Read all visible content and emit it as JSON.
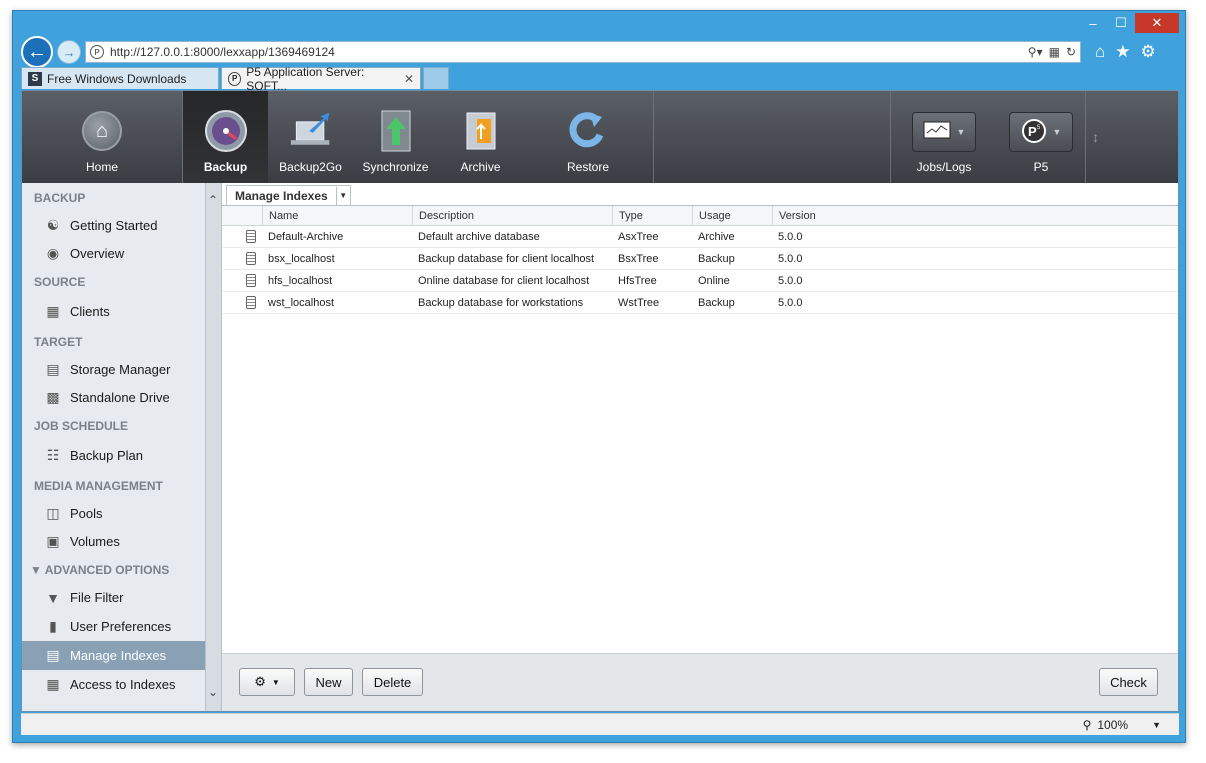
{
  "browser": {
    "url": "http://127.0.0.1:8000/lexxapp/1369469124",
    "tabs": [
      {
        "label": "Free Windows Downloads",
        "favicon": "S"
      },
      {
        "label": "P5 Application Server: SOFT...",
        "favicon": "P"
      }
    ],
    "zoom": "100%",
    "window_controls": {
      "minimize": "‒",
      "maximize": "☐",
      "close": "✕"
    }
  },
  "toolbar": {
    "items": [
      {
        "label": "Home",
        "icon": "home-icon"
      },
      {
        "label": "Backup",
        "icon": "backup-gauge-icon"
      },
      {
        "label": "Backup2Go",
        "icon": "laptop-upload-icon"
      },
      {
        "label": "Synchronize",
        "icon": "sync-arrows-icon"
      },
      {
        "label": "Archive",
        "icon": "archive-safe-icon"
      },
      {
        "label": "Restore",
        "icon": "restore-arrow-icon"
      }
    ],
    "right": [
      {
        "label": "Jobs/Logs",
        "icon": "monitor-graph-icon"
      },
      {
        "label": "P5",
        "icon": "p5-logo-icon"
      }
    ]
  },
  "sidebar": {
    "sections": [
      {
        "title": "BACKUP",
        "items": [
          "Getting Started",
          "Overview"
        ]
      },
      {
        "title": "SOURCE",
        "items": [
          "Clients"
        ]
      },
      {
        "title": "TARGET",
        "items": [
          "Storage Manager",
          "Standalone Drive"
        ]
      },
      {
        "title": "JOB SCHEDULE",
        "items": [
          "Backup Plan"
        ]
      },
      {
        "title": "MEDIA MANAGEMENT",
        "items": [
          "Pools",
          "Volumes"
        ]
      },
      {
        "title": "ADVANCED OPTIONS",
        "items": [
          "File Filter",
          "User Preferences",
          "Manage Indexes",
          "Access to Indexes"
        ]
      }
    ],
    "active_item": "Manage Indexes"
  },
  "main": {
    "view_title": "Manage Indexes",
    "columns": [
      "Name",
      "Description",
      "Type",
      "Usage",
      "Version"
    ],
    "rows": [
      [
        "Default-Archive",
        "Default archive database",
        "AsxTree",
        "Archive",
        "5.0.0"
      ],
      [
        "bsx_localhost",
        "Backup database for client localhost",
        "BsxTree",
        "Backup",
        "5.0.0"
      ],
      [
        "hfs_localhost",
        "Online database for client localhost",
        "HfsTree",
        "Online",
        "5.0.0"
      ],
      [
        "wst_localhost",
        "Backup database for workstations",
        "WstTree",
        "Backup",
        "5.0.0"
      ]
    ],
    "buttons": {
      "new": "New",
      "delete": "Delete",
      "check": "Check"
    }
  },
  "colors": {
    "chrome": "#3fa2dc",
    "toolbar": "#45484d",
    "active_item": "#8aa0b5"
  }
}
